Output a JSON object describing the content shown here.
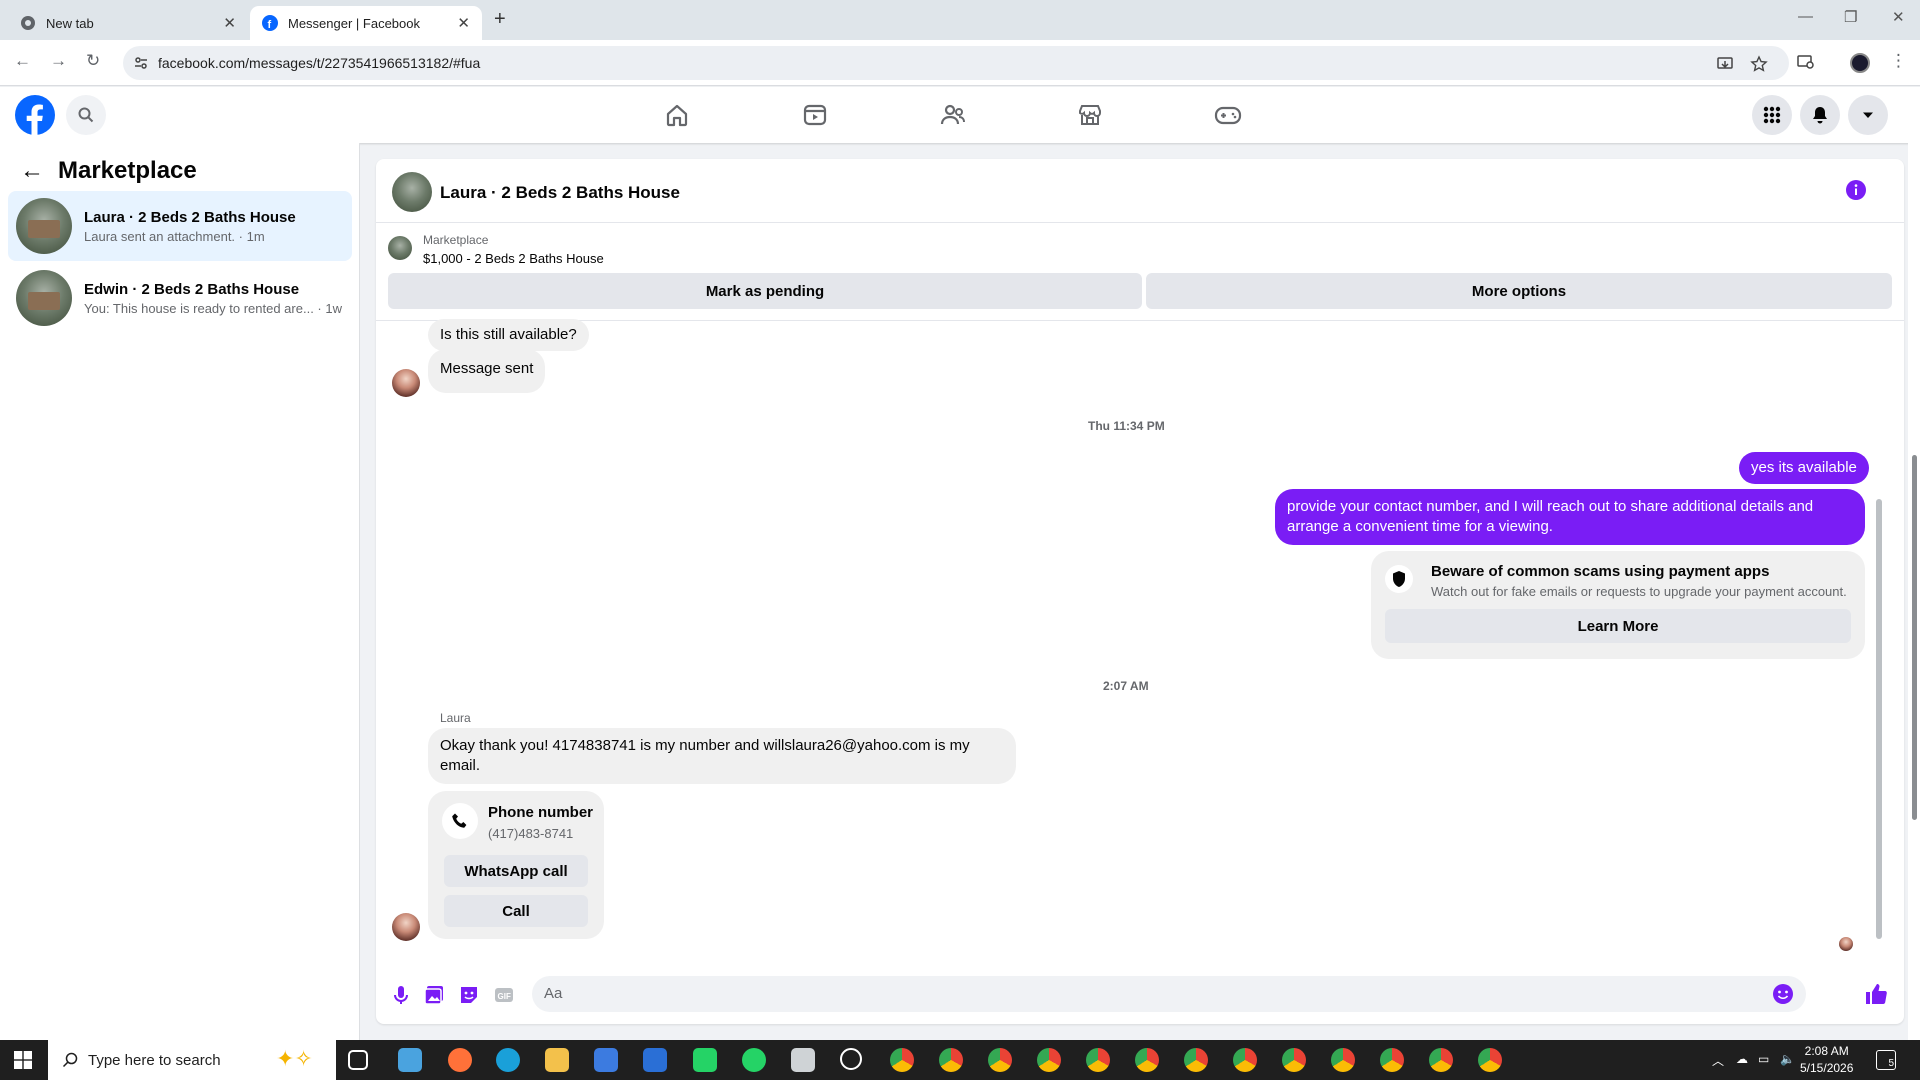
{
  "browser": {
    "tabs": [
      {
        "label": "New tab",
        "active": false
      },
      {
        "label": "Messenger | Facebook",
        "active": true
      }
    ],
    "url": "facebook.com/messages/t/2273541966513182/#fua"
  },
  "fb": {
    "colors": {
      "brand": "#0866ff",
      "accent_purple": "#7a1df5"
    }
  },
  "left_panel": {
    "title": "Marketplace",
    "conversations": [
      {
        "name": "Laura · 2 Beds 2 Baths House",
        "preview": "Laura sent an attachment. · 1m",
        "selected": true
      },
      {
        "name": "Edwin · 2 Beds 2 Baths House",
        "preview": "You: This house is ready to rented are... · 1w",
        "selected": false
      }
    ]
  },
  "chat": {
    "title": "Laura · 2 Beds 2 Baths House",
    "listing": {
      "source": "Marketplace",
      "price_title": "$1,000 - 2 Beds 2 Baths House",
      "mark_pending": "Mark as pending",
      "more_options": "More options"
    },
    "messages": {
      "m1": "Is this still available?",
      "m2": "Message sent",
      "ts1": "Thu 11:34 PM",
      "o1": "yes its available",
      "o2": "provide your contact number, and I will reach out to share additional details and arrange a convenient time for a viewing.",
      "scam_title": "Beware of common scams using payment apps",
      "scam_sub": "Watch out for fake emails or requests to upgrade your payment account.",
      "learn_more": "Learn More",
      "ts2": "2:07 AM",
      "sender": "Laura",
      "m3": "Okay thank you! 4174838741 is my number and willslaura26@yahoo.com is my email.",
      "phone_title": "Phone number",
      "phone_number": "(417)483-8741",
      "whatsapp": "WhatsApp call",
      "call": "Call"
    },
    "composer_placeholder": "Aa"
  },
  "taskbar": {
    "search_placeholder": "Type here to search",
    "time": "2:08 AM",
    "date": "5/15/2026",
    "notification_count": "5"
  }
}
